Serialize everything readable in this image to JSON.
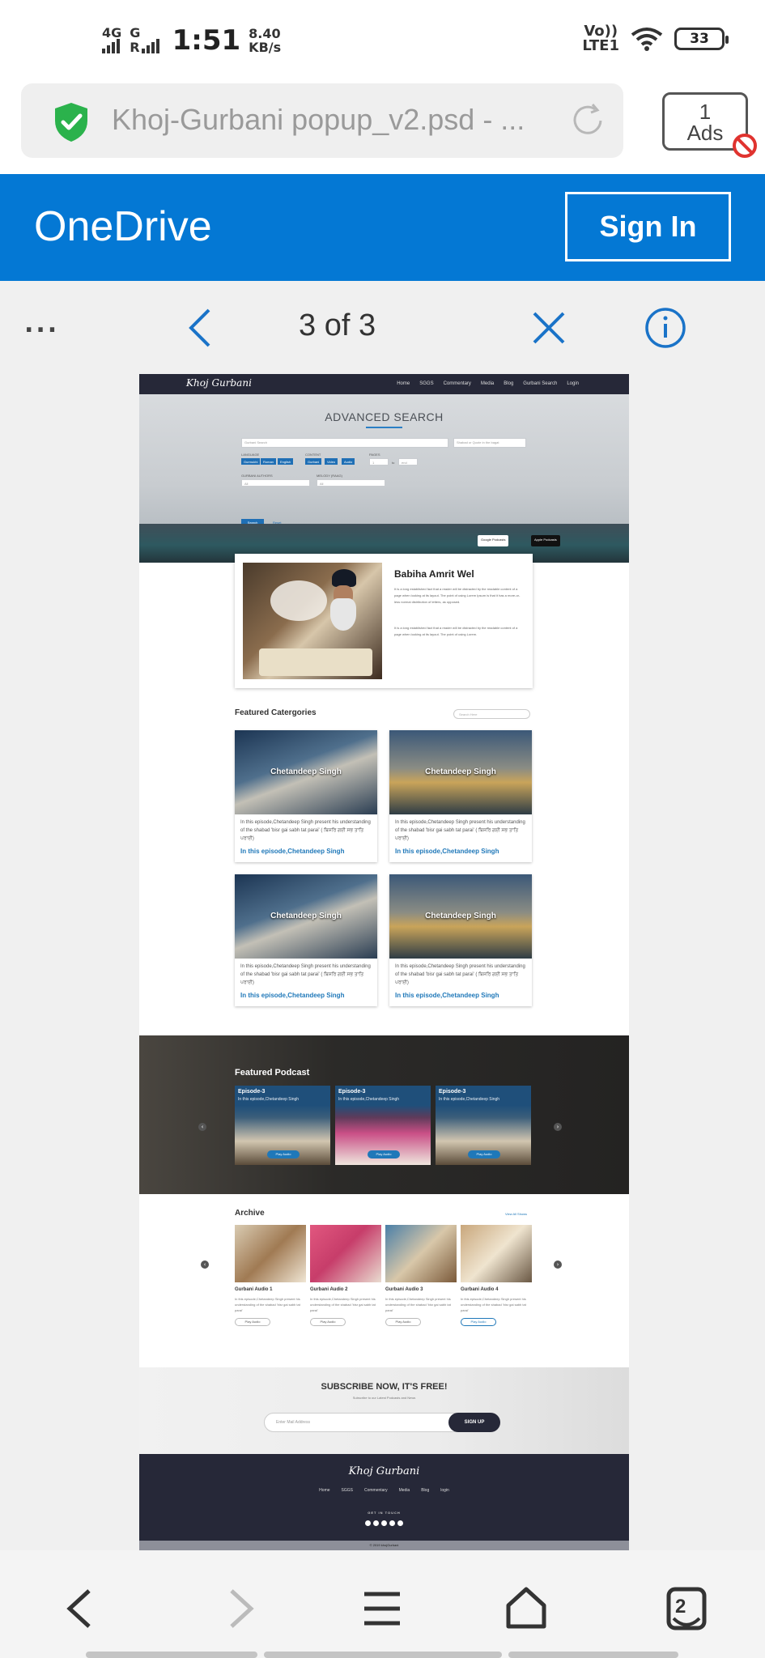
{
  "status_bar": {
    "network_1": "4G",
    "network_2": "G",
    "roaming": "R",
    "time": "1:51",
    "speed_value": "8.40",
    "speed_unit": "KB/s",
    "volte": "Vo))",
    "lte": "LTE1",
    "battery": "33"
  },
  "browser": {
    "url_title": "Khoj-Gurbani popup_v2.psd - ...",
    "ads_count": "1",
    "ads_label": "Ads"
  },
  "onedrive": {
    "title": "OneDrive",
    "sign_in": "Sign In"
  },
  "viewer": {
    "more": "...",
    "page_indicator": "3 of 3"
  },
  "document": {
    "logo": "Khoj Gurbani",
    "nav": [
      "Home",
      "SGGS",
      "Commentary",
      "Media",
      "Blog",
      "Gurbani Search",
      "Login"
    ],
    "hero": {
      "title": "ADVANCED SEARCH",
      "search_placeholder": "Gurbani Search",
      "scope": "Shabad or Quote in the bagat",
      "label_language": "LANGUAGE",
      "lang_options": [
        "Gurmukhi",
        "Roman",
        "English"
      ],
      "label_content": "CONTENT",
      "content_options": [
        "Gurbani",
        "Video",
        "Audio"
      ],
      "label_pages": "PAGES",
      "pages_from": "1",
      "pages_to": "end",
      "pages_sep": "to",
      "label_author": "GURBANI AUTHORS",
      "author_value": "All",
      "label_raag": "MELODY (RAAG)",
      "raag_value": "All",
      "search_btn": "Search",
      "reset": "Reset"
    },
    "badges": {
      "google": "Google Podcasts",
      "apple": "Apple Podcasts"
    },
    "profile": {
      "name": "Babiha Amrit Wel",
      "para1": "It is a long established fact that a reader will be distracted by the readable content of a page when looking at its layout. The point of using Lorem Ipsum is that it has a more-or-less normal distribution of letters, as opposed.",
      "para2": "It is a long established fact that a reader will be distracted by the readable content of a page when looking at its layout. The point of using Lorem."
    },
    "featured": {
      "title": "Featured Catergories",
      "search_placeholder": "Search Here",
      "cards": [
        {
          "name": "Chetandeep Singh",
          "desc": "In this episode,Chetandeep Singh present his understanding of the shabad 'bisr gai sabh tat parai' ( ਬਿਸਰਿ ਗਈ ਸਭ ਤਾਤਿ ਪਰਾਈ)",
          "link": "In this episode,Chetandeep Singh"
        },
        {
          "name": "Chetandeep Singh",
          "desc": "In this episode,Chetandeep Singh present his understanding of the shabad 'bisr gai sabh tat parai' ( ਬਿਸਰਿ ਗਈ ਸਭ ਤਾਤਿ ਪਰਾਈ)",
          "link": "In this episode,Chetandeep Singh"
        },
        {
          "name": "Chetandeep Singh",
          "desc": "In this episode,Chetandeep Singh present his understanding of the shabad 'bisr gai sabh tat parai' ( ਬਿਸਰਿ ਗਈ ਸਭ ਤਾਤਿ ਪਰਾਈ)",
          "link": "In this episode,Chetandeep Singh"
        },
        {
          "name": "Chetandeep Singh",
          "desc": "In this episode,Chetandeep Singh present his understanding of the shabad 'bisr gai sabh tat parai' ( ਬਿਸਰਿ ਗਈ ਸਭ ਤਾਤਿ ਪਰਾਈ)",
          "link": "In this episode,Chetandeep Singh"
        }
      ]
    },
    "podcast": {
      "title": "Featured Podcast",
      "episodes": [
        {
          "title": "Episode-3",
          "sub": "In this episode,Chetandeep Singh",
          "play": "Play Audio"
        },
        {
          "title": "Episode-3",
          "sub": "In this episode,Chetandeep Singh",
          "play": "Play Audio"
        },
        {
          "title": "Episode-3",
          "sub": "In this episode,Chetandeep Singh",
          "play": "Play Audio"
        }
      ]
    },
    "archive": {
      "title": "Archive",
      "view_all": "View All Shows",
      "items": [
        {
          "name": "Gurbani Audio 1",
          "desc": "In this episode,Chetandeep Singh present his understanding of the shabad 'bisr gai sabh tat parai'",
          "play": "Play Audio"
        },
        {
          "name": "Gurbani Audio 2",
          "desc": "In this episode,Chetandeep Singh present his understanding of the shabad 'bisr gai sabh tat parai'",
          "play": "Play Audio"
        },
        {
          "name": "Gurbani Audio 3",
          "desc": "In this episode,Chetandeep Singh present his understanding of the shabad 'bisr gai sabh tat parai'",
          "play": "Play Audio"
        },
        {
          "name": "Gurbani Audio 4",
          "desc": "In this episode,Chetandeep Singh present his understanding of the shabad 'bisr gai sabh tat parai'",
          "play": "Play Audio"
        }
      ]
    },
    "subscribe": {
      "title": "SUBSCRIBE NOW, IT'S FREE!",
      "subtitle": "Subscribe to our Latest Podcasts and News",
      "placeholder": "Enter Mail Address",
      "button": "SIGN UP"
    },
    "footer": {
      "logo": "Khoj Gurbani",
      "links": [
        "Home",
        "SGGS",
        "Commentary",
        "Media",
        "Blog",
        "login"
      ],
      "get_in_touch": "GET IN TOUCH",
      "copyright": "© 2019 khojGurbani"
    }
  },
  "bottom_nav": {
    "tab_count": "2"
  },
  "colors": {
    "onedrive_blue": "#0478d4",
    "navy": "#262838",
    "link_blue": "#1f78b9"
  },
  "icons": [
    "shield-check-icon",
    "reload-icon",
    "ads-block-icon",
    "back-arrow-icon",
    "close-icon",
    "info-icon",
    "home-icon",
    "menu-icon",
    "tabs-icon"
  ]
}
